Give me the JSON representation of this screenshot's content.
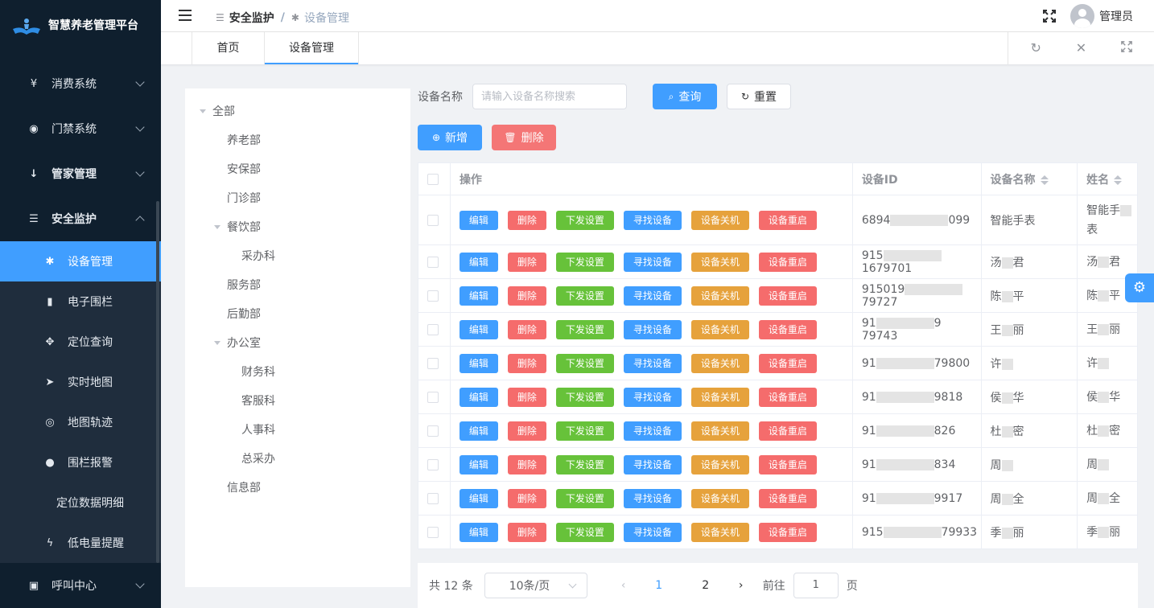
{
  "app": {
    "title": "智慧养老管理平台"
  },
  "sidebar": {
    "menus": [
      {
        "label": "消费系统",
        "icon": "yen-icon"
      },
      {
        "label": "门禁系统",
        "icon": "eye-icon"
      },
      {
        "label": "管家管理",
        "icon": "down-arrow-icon"
      },
      {
        "label": "安全监护",
        "icon": "list-icon"
      }
    ],
    "submenu": [
      {
        "label": "设备管理",
        "icon": "bug-icon"
      },
      {
        "label": "电子围栏",
        "icon": "bar-chart-icon"
      },
      {
        "label": "定位查询",
        "icon": "move-icon"
      },
      {
        "label": "实时地图",
        "icon": "send-icon"
      },
      {
        "label": "地图轨迹",
        "icon": "location-icon"
      },
      {
        "label": "围栏报警",
        "icon": "globe-icon"
      },
      {
        "label": "定位数据明细",
        "icon": ""
      },
      {
        "label": "低电量提醒",
        "icon": "lightning-icon"
      }
    ],
    "bottom_menu": {
      "label": "呼叫中心",
      "icon": "phone-icon"
    }
  },
  "header": {
    "breadcrumb": [
      "安全监护",
      "设备管理"
    ],
    "separator": "/",
    "user": "管理员"
  },
  "tabs": [
    "首页",
    "设备管理"
  ],
  "tree": {
    "root": "全部",
    "nodes": [
      {
        "label": "养老部",
        "level": 1
      },
      {
        "label": "安保部",
        "level": 1
      },
      {
        "label": "门诊部",
        "level": 1
      },
      {
        "label": "餐饮部",
        "level": 1,
        "expanded": true
      },
      {
        "label": "采办科",
        "level": 2
      },
      {
        "label": "服务部",
        "level": 1
      },
      {
        "label": "后勤部",
        "level": 1
      },
      {
        "label": "办公室",
        "level": 1,
        "expanded": true
      },
      {
        "label": "财务科",
        "level": 2
      },
      {
        "label": "客服科",
        "level": 2
      },
      {
        "label": "人事科",
        "level": 2
      },
      {
        "label": "总采办",
        "level": 2
      },
      {
        "label": "信息部",
        "level": 1
      }
    ]
  },
  "search": {
    "label": "设备名称",
    "placeholder": "请输入设备名称搜索",
    "query_label": "查询",
    "reset_label": "重置"
  },
  "actions": {
    "add_label": "新增",
    "delete_label": "删除"
  },
  "table": {
    "headers": [
      "操作",
      "设备ID",
      "设备名称",
      "姓名"
    ],
    "op_labels": [
      "编辑",
      "删除",
      "下发设置",
      "寻找设备",
      "设备关机",
      "设备重启"
    ],
    "rows": [
      {
        "id_a": "6894",
        "id_b": "099",
        "name_a": "智能手表",
        "name_b": "",
        "person_a": "智能手",
        "person_b": "表"
      },
      {
        "id_a": "915",
        "id_b": "1679701",
        "name_a": "汤",
        "name_b": "君",
        "person_a": "汤",
        "person_b": "君"
      },
      {
        "id_a": "915019",
        "id_b": "79727",
        "name_a": "陈",
        "name_b": "平",
        "person_a": "陈",
        "person_b": "平"
      },
      {
        "id_a": "91",
        "id_b": "9  79743",
        "name_a": "王",
        "name_b": "丽",
        "person_a": "王",
        "person_b": "丽"
      },
      {
        "id_a": "91",
        "id_b": "79800",
        "name_a": "许",
        "name_b": "",
        "person_a": "许",
        "person_b": ""
      },
      {
        "id_a": "91",
        "id_b": "9818",
        "name_a": "侯",
        "name_b": "华",
        "person_a": "侯",
        "person_b": "华"
      },
      {
        "id_a": "91",
        "id_b": "826",
        "name_a": "杜",
        "name_b": "密",
        "person_a": "杜",
        "person_b": "密"
      },
      {
        "id_a": "91",
        "id_b": "834",
        "name_a": "周",
        "name_b": "",
        "person_a": "周",
        "person_b": ""
      },
      {
        "id_a": "91",
        "id_b": "9917",
        "name_a": "周",
        "name_b": "全",
        "person_a": "周",
        "person_b": "全"
      },
      {
        "id_a": "915",
        "id_b": "79933",
        "name_a": "季",
        "name_b": "丽",
        "person_a": "季",
        "person_b": "丽"
      }
    ]
  },
  "pagination": {
    "total_text": "共 12 条",
    "page_size": "10条/页",
    "pages": [
      "1",
      "2"
    ],
    "current_page": "1",
    "goto_prefix": "前往",
    "goto_value": "1",
    "goto_suffix": "页"
  },
  "colors": {
    "primary": "#409eff",
    "success": "#67c23a",
    "warning": "#e6a23c",
    "danger": "#f56c6c",
    "sidebar": "#0f1f2e"
  }
}
